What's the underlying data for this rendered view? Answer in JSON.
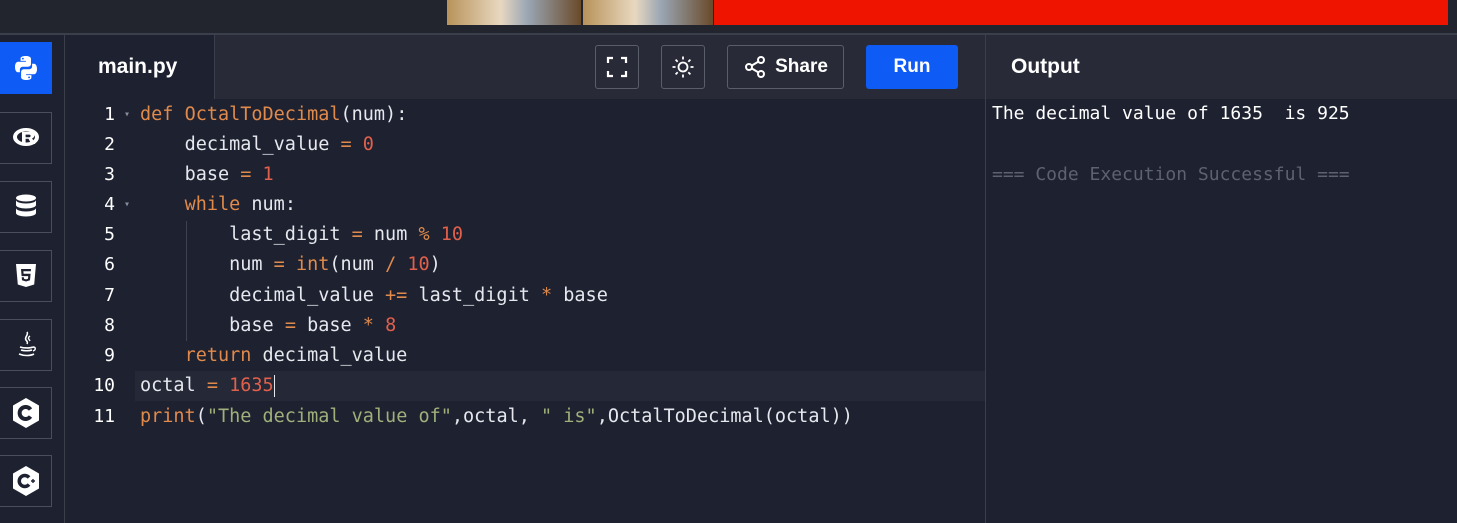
{
  "editor": {
    "filename": "main.py",
    "share_label": "Share",
    "run_label": "Run",
    "lines": [
      {
        "num": "1",
        "fold": true
      },
      {
        "num": "2",
        "fold": false
      },
      {
        "num": "3",
        "fold": false
      },
      {
        "num": "4",
        "fold": true
      },
      {
        "num": "5",
        "fold": false
      },
      {
        "num": "6",
        "fold": false
      },
      {
        "num": "7",
        "fold": false
      },
      {
        "num": "8",
        "fold": false
      },
      {
        "num": "9",
        "fold": false
      },
      {
        "num": "10",
        "fold": false
      },
      {
        "num": "11",
        "fold": false
      }
    ],
    "code": {
      "l1_kw": "def",
      "l1_fn": "OctalToDecimal",
      "l1_rest": "(num):",
      "l2_var": "decimal_value",
      "l2_op": "=",
      "l2_num": "0",
      "l3_var": "base",
      "l3_op": "=",
      "l3_num": "1",
      "l4_kw": "while",
      "l4_rest": "num:",
      "l5_var": "last_digit",
      "l5_op": "=",
      "l5_mid": "num",
      "l5_op2": "%",
      "l5_num": "10",
      "l6_var": "num",
      "l6_op": "=",
      "l6_bi": "int",
      "l6_mid": "(num",
      "l6_op2": "/",
      "l6_num": "10",
      "l6_end": ")",
      "l7_var": "decimal_value",
      "l7_op": "+=",
      "l7_mid": "last_digit",
      "l7_op2": "*",
      "l7_end": "base",
      "l8_var": "base",
      "l8_op": "=",
      "l8_mid": "base",
      "l8_op2": "*",
      "l8_num": "8",
      "l9_kw": "return",
      "l9_rest": "decimal_value",
      "l10_var": "octal",
      "l10_op": "=",
      "l10_num": "1635",
      "l11_bi": "print",
      "l11_p1": "(",
      "l11_str1": "\"The decimal value of\"",
      "l11_mid": ",octal, ",
      "l11_str2": "\" is\"",
      "l11_end": ",OctalToDecimal(octal))"
    }
  },
  "output": {
    "title": "Output",
    "result_line": "The decimal value of 1635  is 925",
    "status_line": "=== Code Execution Successful ==="
  },
  "rail": {
    "items": [
      {
        "name": "python-icon"
      },
      {
        "name": "r-icon"
      },
      {
        "name": "database-icon"
      },
      {
        "name": "html5-icon"
      },
      {
        "name": "java-icon"
      },
      {
        "name": "c-icon"
      },
      {
        "name": "cpp-icon"
      }
    ]
  },
  "colors": {
    "accent": "#0e5bf5",
    "ad_red": "#ef1400",
    "keyword": "#e08a4b",
    "number": "#e0604b",
    "string": "#9fb07a"
  }
}
